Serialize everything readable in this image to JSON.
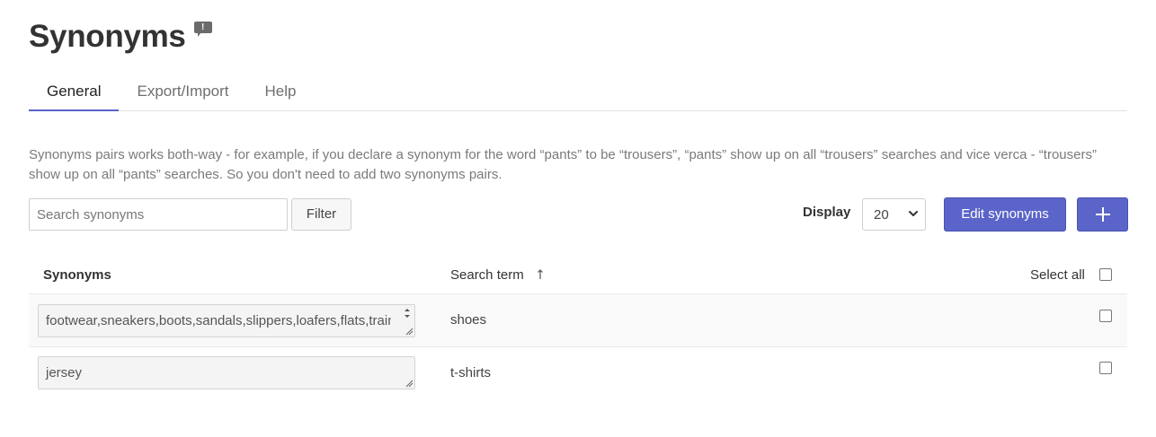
{
  "header": {
    "title": "Synonyms",
    "feedback_icon": "feedback-icon"
  },
  "tabs": [
    {
      "label": "General",
      "active": true
    },
    {
      "label": "Export/Import",
      "active": false
    },
    {
      "label": "Help",
      "active": false
    }
  ],
  "intro_text": "Synonyms pairs works both-way - for example, if you declare a synonym for the word “pants” to be “trousers”, “pants” show up on all “trousers” searches and vice verca - “trousers” show up on all “pants” searches. So you don't need to add two synonyms pairs.",
  "toolbar": {
    "search_placeholder": "Search synonyms",
    "filter_label": "Filter",
    "display_label": "Display",
    "display_value": "20",
    "edit_label": "Edit synonyms",
    "add_icon": "plus-icon"
  },
  "table": {
    "columns": {
      "synonyms": "Synonyms",
      "search_term": "Search term",
      "select_all": "Select all"
    },
    "sort_icon": "sort-ascending-icon",
    "rows": [
      {
        "synonyms": "footwear,sneakers,boots,sandals,slippers,loafers,flats,trainers",
        "search_term": "shoes",
        "checked": false
      },
      {
        "synonyms": "jersey",
        "search_term": "t-shirts",
        "checked": false
      }
    ]
  },
  "colors": {
    "accent": "#5b64c9",
    "text": "#333333",
    "muted": "#7a7a7a"
  }
}
